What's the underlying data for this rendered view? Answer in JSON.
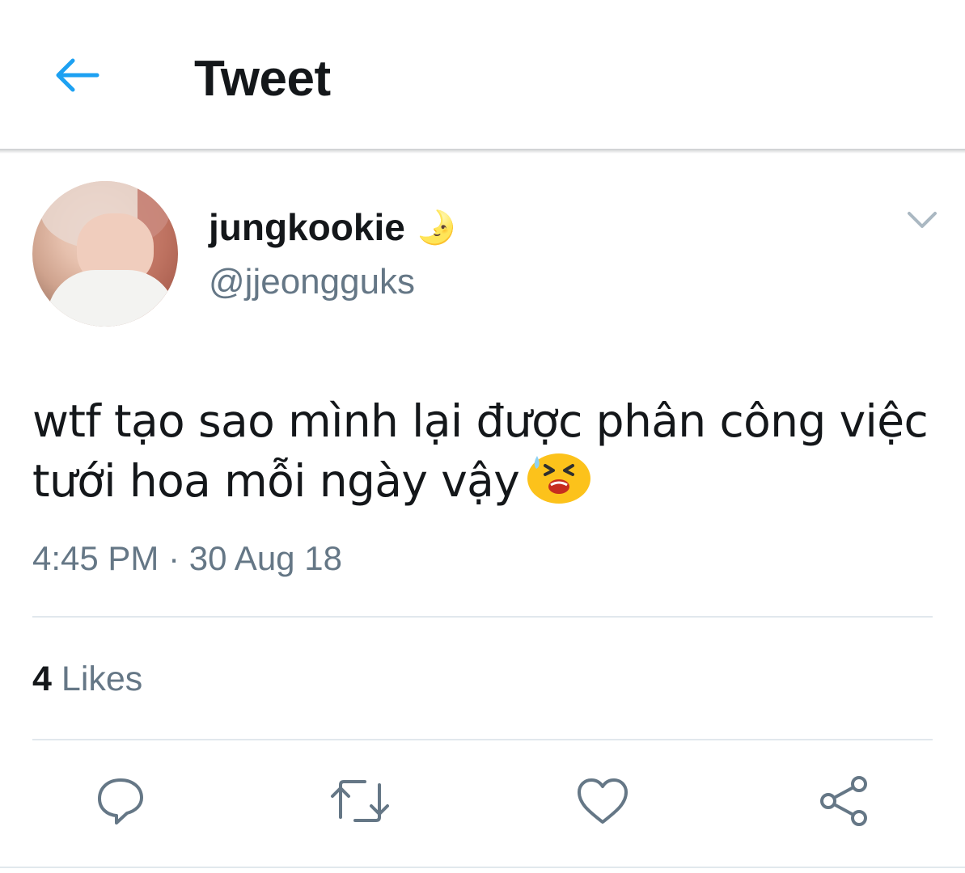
{
  "header": {
    "title": "Tweet",
    "back_icon": "arrow-left-icon",
    "accent_color": "#1da1f2"
  },
  "author": {
    "display_name": "jungkookie",
    "name_emoji": "🌛",
    "handle": "@jjeongguks"
  },
  "tweet": {
    "text": "wtf tạo sao mình lại được phân công việc tưới hoa mỗi ngày vậy",
    "emoji_icon": "tired-face-emoji",
    "timestamp": "4:45 PM · 30 Aug 18"
  },
  "stats": {
    "likes_count": "4",
    "likes_label": "Likes"
  },
  "actions": [
    "reply-icon",
    "retweet-icon",
    "like-icon",
    "share-icon"
  ],
  "colors": {
    "text_primary": "#14171a",
    "text_secondary": "#657786",
    "divider": "#e1e8ed"
  }
}
